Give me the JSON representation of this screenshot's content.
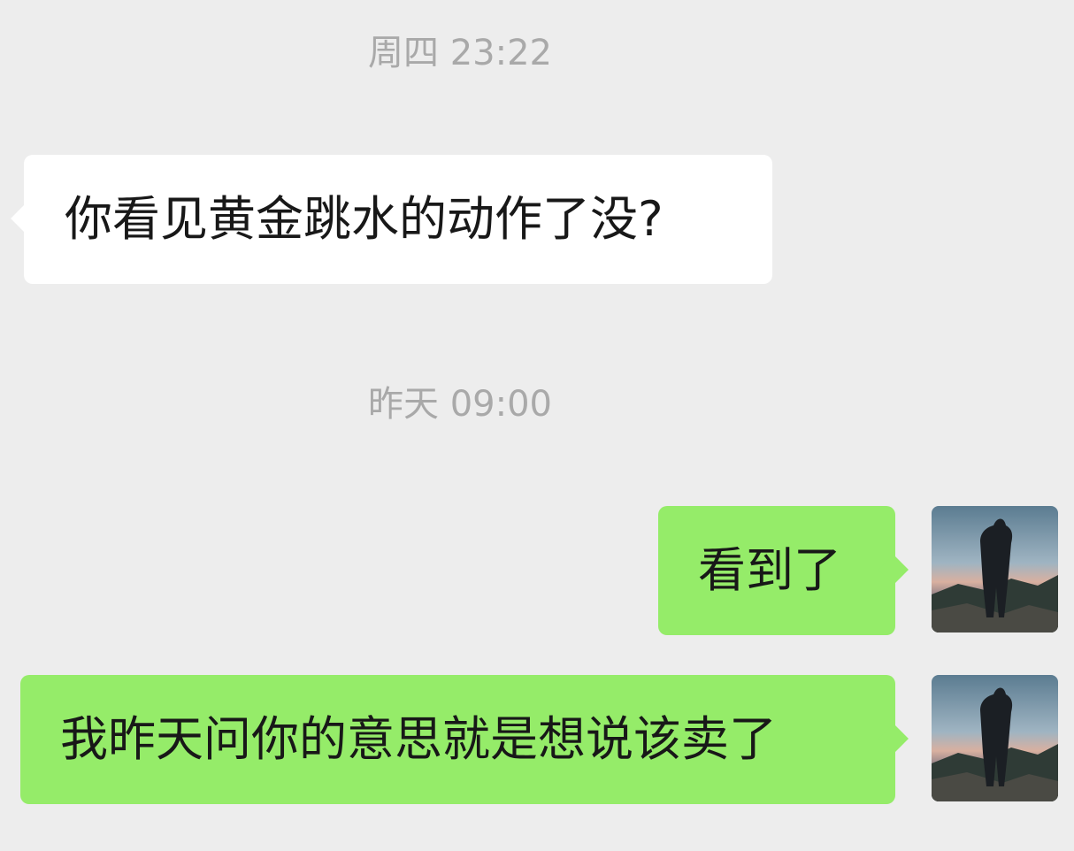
{
  "timestamps": {
    "first": "周四 23:22",
    "second": "昨天 09:00"
  },
  "messages": [
    {
      "side": "left",
      "text": "你看见黄金跳水的动作了没?"
    },
    {
      "side": "right",
      "text": "看到了"
    },
    {
      "side": "right",
      "text": "我昨天问你的意思就是想说该卖了"
    }
  ],
  "colors": {
    "background": "#ededed",
    "incoming_bubble": "#ffffff",
    "outgoing_bubble": "#95ec69",
    "timestamp_text": "#a9a9a9",
    "message_text": "#181818"
  },
  "avatar": {
    "icon": "user-avatar-image"
  }
}
